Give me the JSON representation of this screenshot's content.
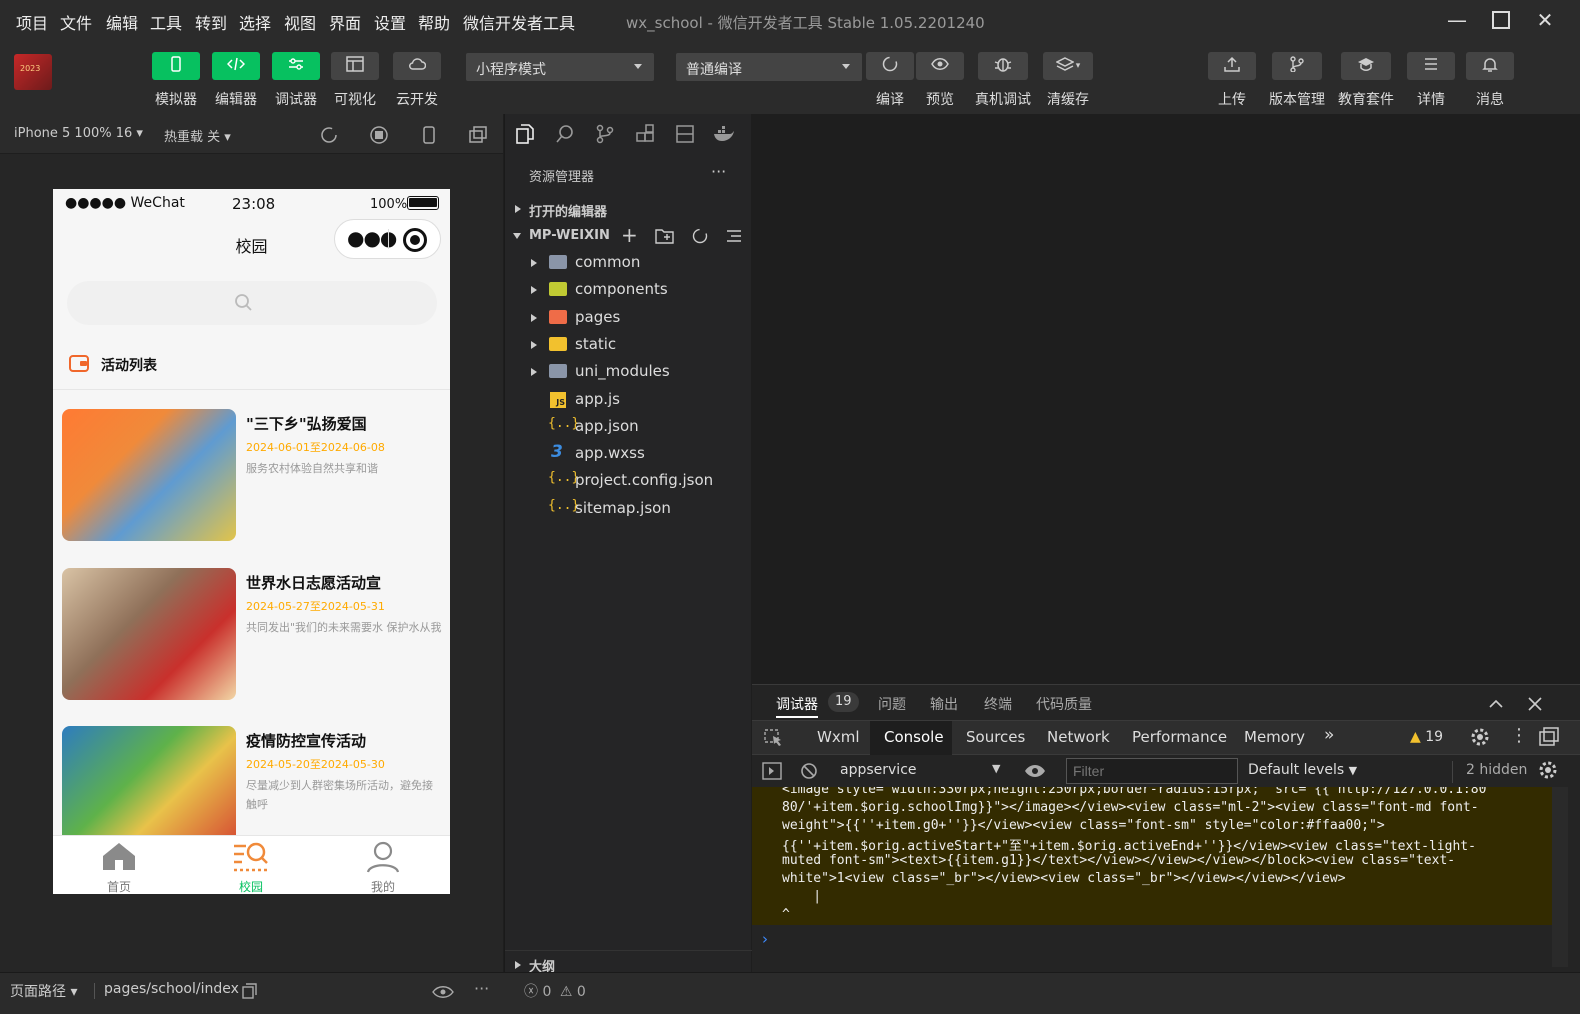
{
  "menu": [
    "项目",
    "文件",
    "编辑",
    "工具",
    "转到",
    "选择",
    "视图",
    "界面",
    "设置",
    "帮助",
    "微信开发者工具"
  ],
  "window_title": "wx_school - 微信开发者工具 Stable 1.05.2201240",
  "toolbar": {
    "left_buttons": [
      {
        "label": "模拟器",
        "icon": "phone-icon",
        "active": true
      },
      {
        "label": "编辑器",
        "icon": "code-icon",
        "active": true
      },
      {
        "label": "调试器",
        "icon": "sliders-icon",
        "active": true
      },
      {
        "label": "可视化",
        "icon": "layout-icon",
        "active": false
      },
      {
        "label": "云开发",
        "icon": "cloud-icon",
        "active": false
      }
    ],
    "mode_select": "小程序模式",
    "compile_select": "普通编译",
    "mid_buttons": [
      {
        "label": "编译",
        "icon": "refresh-icon"
      },
      {
        "label": "预览",
        "icon": "eye-icon"
      },
      {
        "label": "真机调试",
        "icon": "bug-icon"
      },
      {
        "label": "清缓存",
        "icon": "layers-icon"
      }
    ],
    "right_buttons": [
      {
        "label": "上传",
        "icon": "upload-icon"
      },
      {
        "label": "版本管理",
        "icon": "branch-icon"
      },
      {
        "label": "教育套件",
        "icon": "graduation-cap-icon"
      },
      {
        "label": "详情",
        "icon": "menu-icon"
      },
      {
        "label": "消息",
        "icon": "bell-icon"
      }
    ]
  },
  "simulator": {
    "device": "iPhone 5 100% 16 ▾",
    "hot_reload": "热重载 关 ▾",
    "status_bar": {
      "carrier": "●●●●● WeChat",
      "time": "23:08",
      "battery": "100%"
    },
    "nav_title": "校园",
    "section_title": "活动列表",
    "activities": [
      {
        "title": "\"三下乡\"弘扬爱国",
        "date": "2024-06-01至2024-06-08",
        "desc": "服务农村体验自然共享和谐"
      },
      {
        "title": "世界水日志愿活动宣",
        "date": "2024-05-27至2024-05-31",
        "desc": "共同发出\"我们的未来需要水 保护水从我"
      },
      {
        "title": "疫情防控宣传活动",
        "date": "2024-05-20至2024-05-30",
        "desc": "尽量减少到人群密集场所活动，避免接触呼"
      }
    ],
    "tabbar": [
      {
        "label": "首页",
        "active": false
      },
      {
        "label": "校园",
        "active": true
      },
      {
        "label": "我的",
        "active": false
      }
    ]
  },
  "explorer": {
    "title": "资源管理器",
    "more": "···",
    "open_editors": "打开的编辑器",
    "project": "MP-WEIXIN",
    "tree": [
      {
        "name": "common",
        "type": "folder",
        "color": "#8a95a8"
      },
      {
        "name": "components",
        "type": "folder",
        "color": "#c0ca33"
      },
      {
        "name": "pages",
        "type": "folder",
        "color": "#ef6c48"
      },
      {
        "name": "static",
        "type": "folder",
        "color": "#f2c12e"
      },
      {
        "name": "uni_modules",
        "type": "folder",
        "color": "#8a95a8"
      },
      {
        "name": "app.js",
        "type": "js"
      },
      {
        "name": "app.json",
        "type": "json"
      },
      {
        "name": "app.wxss",
        "type": "css"
      },
      {
        "name": "project.config.json",
        "type": "json"
      },
      {
        "name": "sitemap.json",
        "type": "json"
      }
    ],
    "outline": "大纲"
  },
  "debugger": {
    "tabs": [
      "调试器",
      "问题",
      "输出",
      "终端",
      "代码质量"
    ],
    "badge": "19",
    "devtools_tabs": [
      "Wxml",
      "Console",
      "Sources",
      "Network",
      "Performance",
      "Memory"
    ],
    "active_devtools_tab": "Console",
    "warnings": "19",
    "context": "appservice",
    "filter_placeholder": "Filter",
    "levels": "Default levels",
    "hidden": "2 hidden",
    "console_lines": [
      "<image style=\"width:330rpx;height:250rpx;border-radius:15rpx;\" src=\"{{'http://127.0.0.1:80",
      "80/'+item.$orig.schoolImg}}\"></image></view><view class=\"ml-2\"><view class=\"font-md font-",
      "weight\">{{''+item.g0+''}}</view><view class=\"font-sm\" style=\"color:#ffaa00;\">",
      "{{''+item.$orig.activeStart+\"至\"+item.$orig.activeEnd+''}}</view><view class=\"text-light-",
      "muted font-sm\"><text>{{item.g1}}</text></view></view></view></block><view class=\"text-",
      "white\">1<view class=\"_br\"></view><view class=\"_br\"></view></view></view>",
      "    |",
      "^"
    ],
    "prompt": "›"
  },
  "statusbar": {
    "page_path_label": "页面路径 ▾",
    "page_path": "pages/school/index",
    "errors": "0",
    "warnings": "0"
  }
}
